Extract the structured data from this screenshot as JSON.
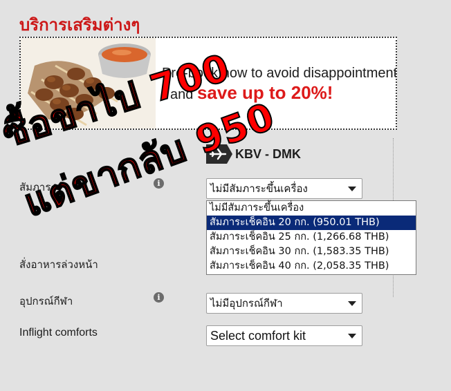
{
  "page": {
    "title": "บริการเสริมต่างๆ"
  },
  "banner": {
    "line1": "Pre-book now to avoid disappointment",
    "line2_prefix": "and",
    "line2_highlight": "save up to 20%",
    "line2_suffix": "!",
    "image_icon": "food-skewers-image"
  },
  "route": {
    "icon": "airplane-icon",
    "text": "KBV - DMK"
  },
  "fields": {
    "baggage": {
      "label": "สัมภาระ",
      "selected": "ไม่มีสัมภาระขึ้นเครื่อง",
      "options": [
        "ไม่มีสัมภาระขึ้นเครื่อง",
        "สัมภาระเช็คอิน 20 กก. (950.01 THB)",
        "สัมภาระเช็คอิน 25 กก. (1,266.68 THB)",
        "สัมภาระเช็คอิน 30 กก. (1,583.35 THB)",
        "สัมภาระเช็คอิน 40 กก. (2,058.35 THB)"
      ],
      "highlighted_index": 1
    },
    "meal": {
      "label": "สั่งอาหารล่วงหน้า"
    },
    "sports": {
      "label": "อุปกรณ์กีฬา",
      "selected": "ไม่มีอุปกรณ์กีฬา"
    },
    "comfort": {
      "label": "Inflight comforts",
      "selected": "Select comfort kit"
    }
  },
  "overlay": {
    "line1": "ซื้อขาไป 700",
    "line2": "แต่ขากลับ 950"
  },
  "colors": {
    "title_red": "#cc1818",
    "selected_option_bg": "#0a2a78",
    "overlay_red": "#ff0000"
  }
}
